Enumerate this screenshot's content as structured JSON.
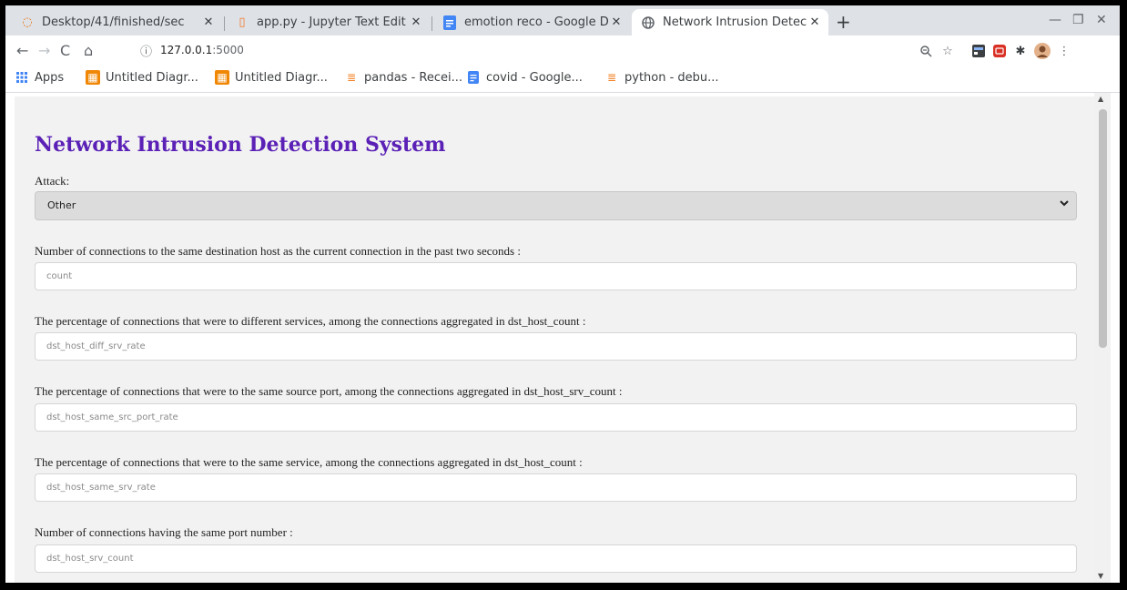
{
  "browser": {
    "tabs": [
      {
        "title": "Desktop/41/finished/sec",
        "icon": "loading-icon"
      },
      {
        "title": "app.py - Jupyter Text Edit",
        "icon": "jupyter-file-icon"
      },
      {
        "title": "emotion reco - Google Do",
        "icon": "google-docs-icon"
      },
      {
        "title": "Network Intrusion Detect",
        "icon": "globe-icon"
      }
    ],
    "url_host": "127.0.0.1",
    "url_port": ":5000",
    "bookmarks": [
      {
        "label": "Apps",
        "icon": "apps-grid-icon"
      },
      {
        "label": "Untitled Diagr...",
        "icon": "drawio-icon"
      },
      {
        "label": "Untitled Diagr...",
        "icon": "drawio-icon"
      },
      {
        "label": "pandas - Recei...",
        "icon": "stackoverflow-icon"
      },
      {
        "label": "covid - Google...",
        "icon": "google-docs-icon"
      },
      {
        "label": "python - debu...",
        "icon": "stackoverflow-icon"
      }
    ]
  },
  "page": {
    "title": "Network Intrusion Detection System",
    "attack_label": "Attack:",
    "attack_selected": "Other",
    "fields": [
      {
        "label": "Number of connections to the same destination host as the current connection in the past two seconds :",
        "placeholder": "count"
      },
      {
        "label": "The percentage of connections that were to different services, among the connections aggregated in dst_host_count :",
        "placeholder": "dst_host_diff_srv_rate"
      },
      {
        "label": "The percentage of connections that were to the same source port, among the connections aggregated in dst_host_srv_count :",
        "placeholder": "dst_host_same_src_port_rate"
      },
      {
        "label": "The percentage of connections that were to the same service, among the connections aggregated in dst_host_count :",
        "placeholder": "dst_host_same_srv_rate"
      },
      {
        "label": "Number of connections having the same port number :",
        "placeholder": "dst_host_srv_count"
      }
    ]
  },
  "colors": {
    "title": "#5b21b6",
    "page_bg": "#f2f2f2",
    "tabstrip_bg": "#dee1e6"
  }
}
